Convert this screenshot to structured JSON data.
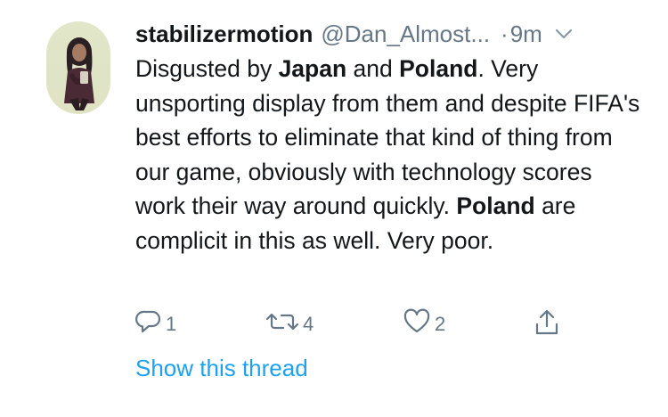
{
  "tweet": {
    "display_name": "stabilizermotion",
    "handle": "@Dan_Almost...",
    "separator": "·",
    "time": "9m",
    "text_parts": [
      "Disgusted by ",
      "Japan",
      " and ",
      "Poland",
      ". Very unsporting display from them and despite FIFA's best efforts to eliminate that kind of thing from our game, obviously with technology scores work their way around quickly. ",
      "Poland",
      " are complicit in this as well. Very poor."
    ],
    "actions": {
      "reply_count": "1",
      "retweet_count": "4",
      "like_count": "2"
    },
    "show_thread_label": "Show this thread"
  },
  "colors": {
    "text": "#14171a",
    "secondary": "#657786",
    "link": "#1da1f2"
  },
  "icons": [
    "reply-icon",
    "retweet-icon",
    "like-icon",
    "share-icon",
    "chevron-down-icon"
  ]
}
